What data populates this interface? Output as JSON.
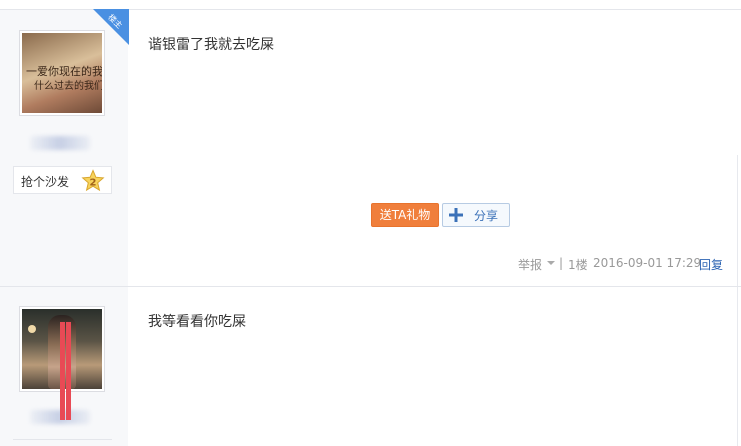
{
  "post1": {
    "badge": "楼主",
    "sofa_label": "抢个沙发",
    "sofa_rank": "2",
    "content": "谐银雷了我就去吃屎",
    "avatar_text_line1": "一爱你现在的我一",
    "avatar_text_line2": "什么过去的我们",
    "gift_button": "送TA礼物",
    "share_button": "分享",
    "report": "举报",
    "separator": "|",
    "floor": "1楼",
    "timestamp": "2016-09-01 17:29",
    "reply": "回复"
  },
  "post2": {
    "content": "我等看看你吃屎"
  },
  "colors": {
    "gift_orange": "#f07f3c",
    "link_blue": "#2d64b3",
    "badge_blue": "#4a90e2"
  }
}
